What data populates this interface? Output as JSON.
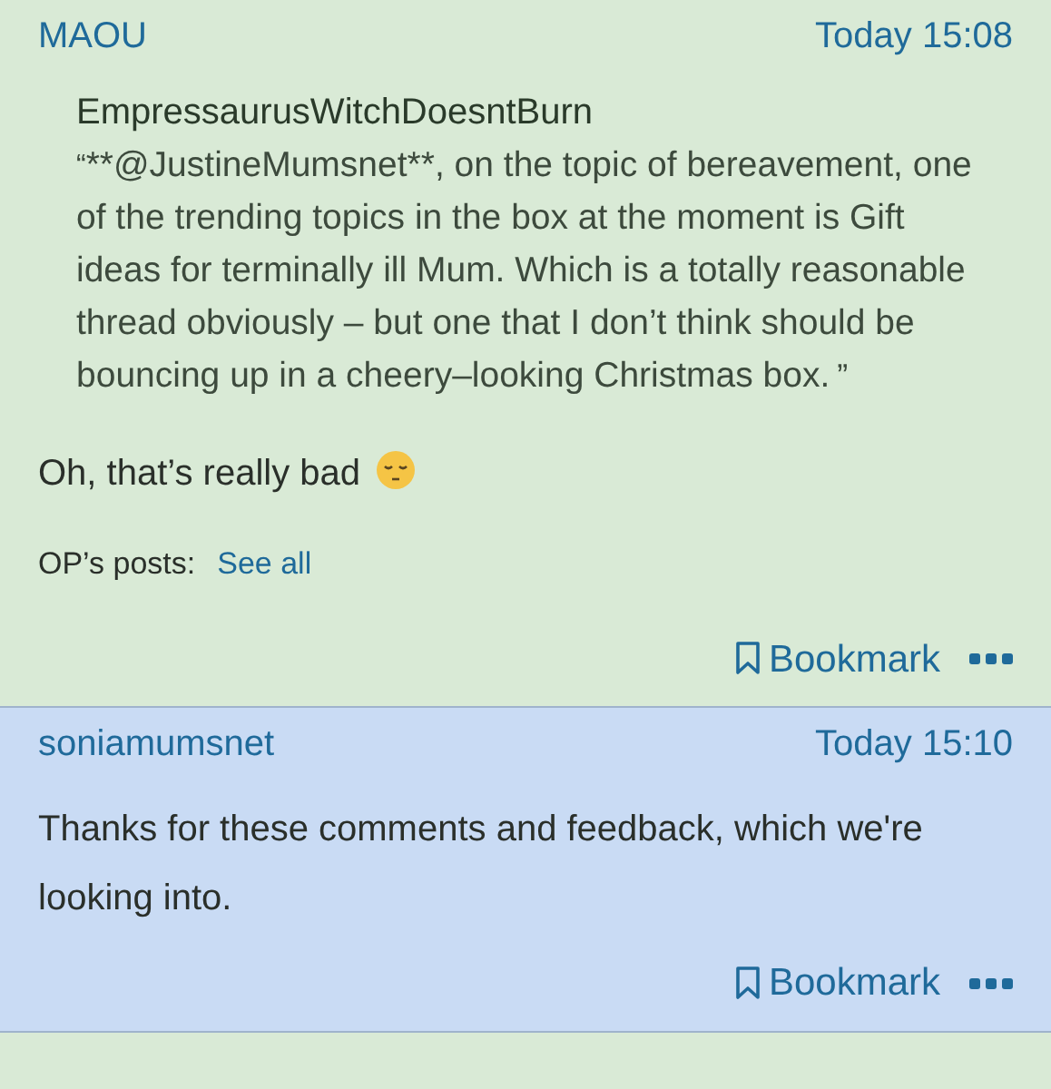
{
  "posts": [
    {
      "author": "MAOU",
      "time": "Today 15:08",
      "quote": {
        "author": "EmpressaurusWitchDoesntBurn",
        "open_mark": "“",
        "text": "**@JustineMumsnet**, on the topic of bereavement, one of the trending topics in the box at the moment is Gift ideas for terminally ill Mum. Which is a totally reasonable thread obviously – but one that I don’t think should be bouncing up in a cheery–looking Christmas box.",
        "close_mark": "”"
      },
      "body": "Oh, that’s really bad",
      "emoji": true,
      "op_posts": {
        "label": "OP’s posts:",
        "link": "See all"
      },
      "bookmark": "Bookmark",
      "kind": "op"
    },
    {
      "author": "soniamumsnet",
      "time": "Today 15:10",
      "body": "Thanks for these comments and feedback, which we're looking into.",
      "emoji": false,
      "bookmark": "Bookmark",
      "kind": "staff"
    }
  ]
}
